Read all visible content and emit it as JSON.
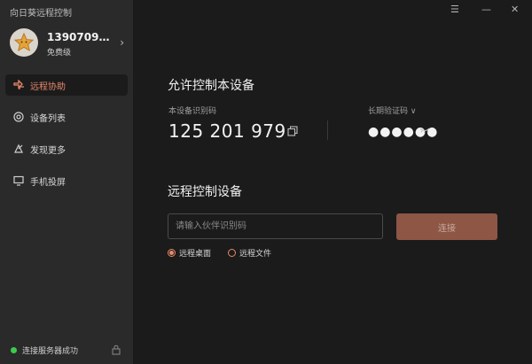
{
  "app": {
    "title": "向日葵远程控制"
  },
  "user": {
    "name": "13907092...",
    "level": "免费级"
  },
  "nav": {
    "items": [
      {
        "label": "远程协助",
        "icon": "remote-assist-icon",
        "active": true
      },
      {
        "label": "设备列表",
        "icon": "device-list-icon",
        "active": false
      },
      {
        "label": "发现更多",
        "icon": "discover-icon",
        "active": false
      },
      {
        "label": "手机投屏",
        "icon": "screen-cast-icon",
        "active": false
      }
    ]
  },
  "status": {
    "text": "连接服务器成功",
    "color": "#3ccc4b"
  },
  "window_controls": {
    "menu": "☰",
    "minimize": "—",
    "close": "✕"
  },
  "allow": {
    "title": "允许控制本设备",
    "id_label": "本设备识别码",
    "device_id": "125 201 979",
    "code_label": "长期验证码 ∨",
    "code_mask": "●●●●●●"
  },
  "remote": {
    "title": "远程控制设备",
    "input_placeholder": "请输入伙伴识别码",
    "input_value": "",
    "connect_label": "连接",
    "options": [
      {
        "label": "远程桌面",
        "selected": true
      },
      {
        "label": "远程文件",
        "selected": false
      }
    ]
  },
  "colors": {
    "accent": "#e8896b",
    "connect_bg": "#8d5645",
    "sidebar_bg": "#2a2a2a",
    "main_bg": "#1b1b1b"
  }
}
